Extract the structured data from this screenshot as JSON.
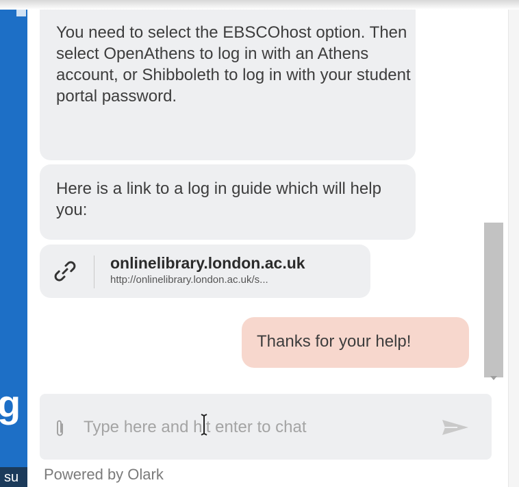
{
  "messages": {
    "bubble_1": "You need to select the EBSCOhost option. Then select OpenAthens to log in with an Athens account, or Shibboleth to log in with your student portal password.",
    "bubble_2": "Here is a link to a log in guide which will help you:",
    "link_card": {
      "title": "onlinelibrary.london.ac.uk",
      "url": "http://onlinelibrary.london.ac.uk/s...",
      "icon": "link-icon"
    },
    "user_message": "Thanks for your help!"
  },
  "composer": {
    "placeholder": "Type here and hit enter to chat",
    "value": "",
    "attach_icon": "paperclip-icon",
    "send_icon": "send-icon"
  },
  "footer": {
    "powered_by": "Powered by Olark"
  },
  "background_fragments": {
    "letter": "g",
    "text": "su"
  },
  "colors": {
    "agent_bubble": "#eeeff1",
    "visitor_bubble": "#f7d7cd",
    "page_strip": "#1d6fc6",
    "scrollbar_thumb": "#c2c2c2"
  }
}
